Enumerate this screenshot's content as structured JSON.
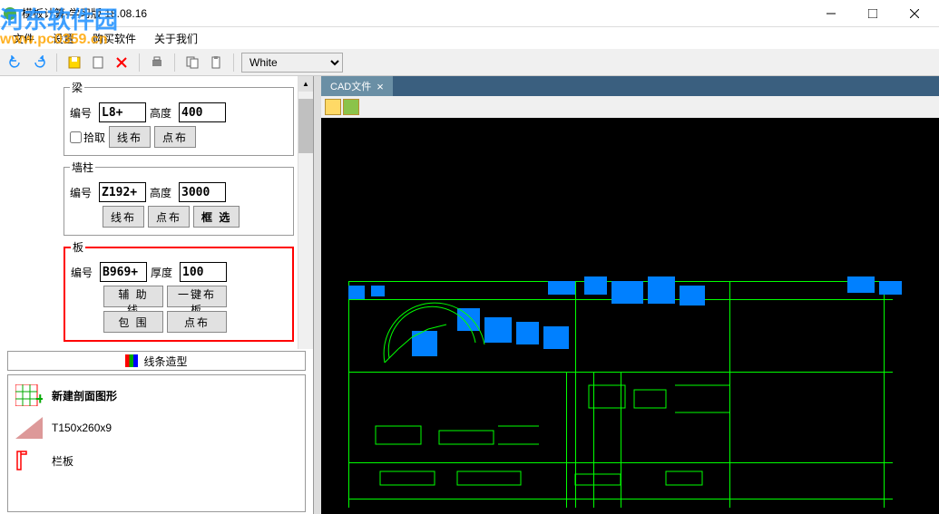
{
  "window": {
    "title": "模板计算-学习版 18.08.16"
  },
  "watermark": {
    "title": "河东软件园",
    "url": "www.pc0359.cn"
  },
  "menu": {
    "file": "文件",
    "settings": "设置",
    "buy": "购买软件",
    "about": "关于我们"
  },
  "toolbar": {
    "color_value": "White"
  },
  "beam": {
    "legend": "梁",
    "id_label": "编号",
    "id_value": "L8+",
    "height_label": "高度",
    "height_value": "400",
    "pick_label": "拾取",
    "line_btn": "线布",
    "point_btn": "点布"
  },
  "wall": {
    "legend": "墙柱",
    "id_label": "编号",
    "id_value": "Z192+",
    "height_label": "高度",
    "height_value": "3000",
    "line_btn": "线布",
    "point_btn": "点布",
    "box_btn": "框 选"
  },
  "slab": {
    "legend": "板",
    "id_label": "编号",
    "id_value": "B969+",
    "thick_label": "厚度",
    "thick_value": "100",
    "aux_btn": "辅 助 线",
    "onekey_btn": "一键布板",
    "enclose_btn": "包 围",
    "point_btn": "点布"
  },
  "section_header": "线条造型",
  "list": {
    "item1": "新建剖面图形",
    "item2": "T150x260x9",
    "item3": "栏板"
  },
  "cad": {
    "tab_label": "CAD文件"
  }
}
